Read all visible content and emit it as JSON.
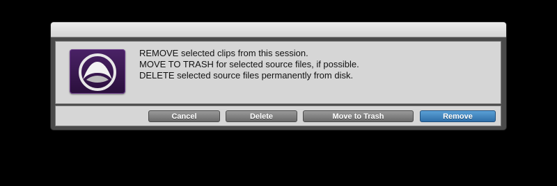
{
  "dialog": {
    "message_lines": [
      "REMOVE selected clips from this session.",
      "MOVE TO TRASH for selected source files, if possible.",
      "DELETE selected source files permanently from disk."
    ],
    "icon": "pro-tools-app-icon"
  },
  "buttons": {
    "cancel": "Cancel",
    "delete": "Delete",
    "move_to_trash": "Move to Trash",
    "remove": "Remove"
  },
  "colors": {
    "default_button": "#2f6fa8",
    "button": "#6a6a6a",
    "panel": "#d6d6d6",
    "icon_background": "#3a1a52"
  }
}
